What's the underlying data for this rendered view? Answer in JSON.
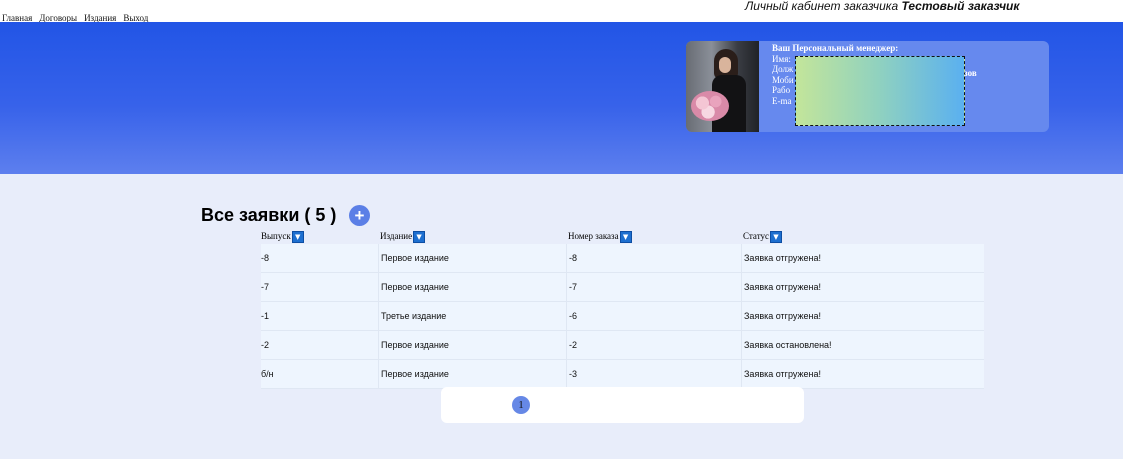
{
  "nav": {
    "items": [
      {
        "label": "Главная"
      },
      {
        "label": "Договоры"
      },
      {
        "label": "Издания"
      },
      {
        "label": "Выход"
      }
    ]
  },
  "header": {
    "cabinet_prefix": "Личный кабинет заказчика",
    "customer_name": "Тестовый заказчик"
  },
  "manager": {
    "title": "Ваш Персональный менеджер:",
    "lines": [
      "Имя:",
      "Долж",
      "Моби",
      "Рабо",
      "E-ma"
    ],
    "tail_fragment": "зов"
  },
  "orders": {
    "heading": "Все заявки ( 5 )",
    "add_button": "+",
    "sort_icon": "▼",
    "columns": [
      "Выпуск",
      "Издание",
      "Номер заказа",
      "Статус"
    ],
    "rows": [
      {
        "issue": "-8",
        "edition": "Первое издание",
        "order": "-8",
        "status": "Заявка отгружена!"
      },
      {
        "issue": "-7",
        "edition": "Первое издание",
        "order": "-7",
        "status": "Заявка отгружена!"
      },
      {
        "issue": "-1",
        "edition": "Третье издание",
        "order": "-6",
        "status": "Заявка отгружена!"
      },
      {
        "issue": "-2",
        "edition": "Первое издание",
        "order": "-2",
        "status": "Заявка остановлена!"
      },
      {
        "issue": "б/н",
        "edition": "Первое издание",
        "order": "-3",
        "status": "Заявка отгружена!"
      }
    ]
  },
  "pagination": {
    "pages": [
      "1"
    ]
  },
  "colors": {
    "hero_blue": "#2255e6",
    "page_bg": "#e8edfa",
    "row_bg": "#eef5fe",
    "accent": "#5b7fe6"
  }
}
